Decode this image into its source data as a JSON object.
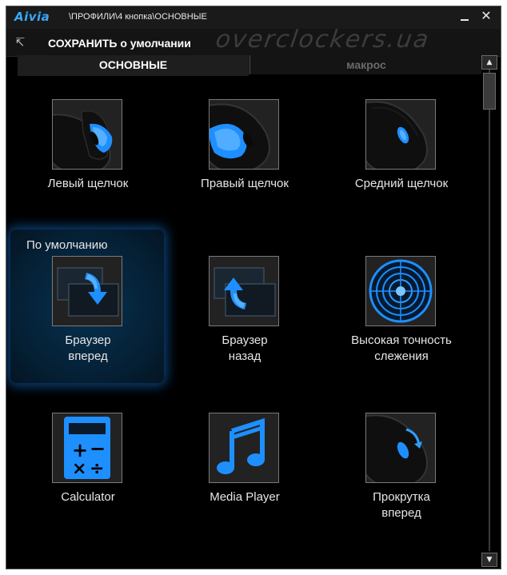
{
  "window": {
    "logo": "Aivia",
    "path": "\\ПРОФИЛИ\\4 кнопка\\ОСНОВНЫЕ",
    "close_glyph": "✕"
  },
  "toolbar": {
    "back_icon": "↸",
    "save_label": "СОХРАНИТЬ о умолчании",
    "watermark": "overclockers.ua"
  },
  "tabs": [
    {
      "label": "ОСНОВНЫЕ",
      "active": true
    },
    {
      "label": "макрос",
      "active": false
    }
  ],
  "scrollbar": {
    "up": "▲",
    "down": "▼"
  },
  "default_slot_label": "По умолчанию",
  "items": [
    {
      "label": "Левый щелчок",
      "icon": "mouse-left-click-icon"
    },
    {
      "label": "Правый щелчок",
      "icon": "mouse-right-click-icon"
    },
    {
      "label": "Средний щелчок",
      "icon": "mouse-middle-click-icon"
    },
    {
      "label_line1": "Браузер",
      "label_line2": "вперед",
      "icon": "browser-forward-icon"
    },
    {
      "label_line1": "Браузер",
      "label_line2": "назад",
      "icon": "browser-back-icon"
    },
    {
      "label_line1": "Высокая точность",
      "label_line2": "слежения",
      "icon": "precision-tracking-icon"
    },
    {
      "label": "Calculator",
      "icon": "calculator-icon"
    },
    {
      "label": "Media Player",
      "icon": "media-player-icon"
    },
    {
      "label_line1": "Прокрутка",
      "label_line2": "вперед",
      "icon": "scroll-forward-icon"
    }
  ],
  "colors": {
    "accent": "#35a9ff",
    "glow": "#1e8fff",
    "background": "#000000"
  }
}
